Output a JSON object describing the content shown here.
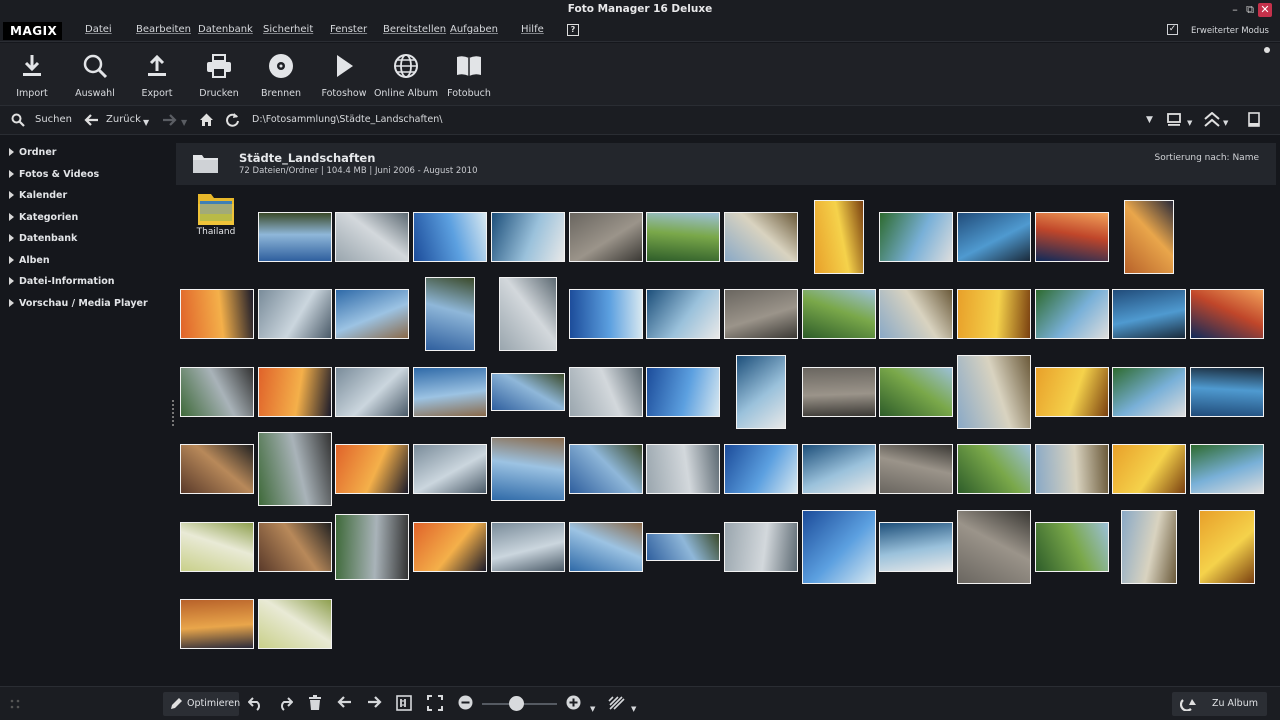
{
  "window": {
    "title": "Foto Manager 16 Deluxe"
  },
  "menubar": {
    "logo": "MAGIX",
    "items": [
      "Datei",
      "Bearbeiten",
      "Datenbank",
      "Sicherheit",
      "Fenster",
      "Bereitstellen",
      "Aufgaben",
      "Hilfe"
    ],
    "mode_label": "Erweiterter Modus"
  },
  "toolbar": {
    "tools": [
      "Import",
      "Auswahl",
      "Export",
      "Drucken",
      "Brennen",
      "Fotoshow",
      "Online Album",
      "Fotobuch"
    ]
  },
  "navbar": {
    "search_label": "Suchen",
    "back_label": "Zurück",
    "path": "D:\\Fotosammlung\\Städte_Landschaften\\"
  },
  "sidebar": {
    "items": [
      "Ordner",
      "Fotos & Videos",
      "Kalender",
      "Kategorien",
      "Datenbank",
      "Alben",
      "Datei-Information",
      "Vorschau / Media Player"
    ]
  },
  "folder": {
    "name": "Städte_Landschaften",
    "info": "72 Dateien/Ordner | 104.4 MB | Juni 2006 - August 2010",
    "sort_label": "Sortierung nach: Name"
  },
  "subfolder": {
    "name": "Thailand"
  },
  "bottombar": {
    "optimize_label": "Optimieren",
    "album_label": "Zu Album"
  },
  "colors": {
    "background": "#15171c",
    "toolbar": "#1f2126",
    "close_button": "#c4314b"
  }
}
